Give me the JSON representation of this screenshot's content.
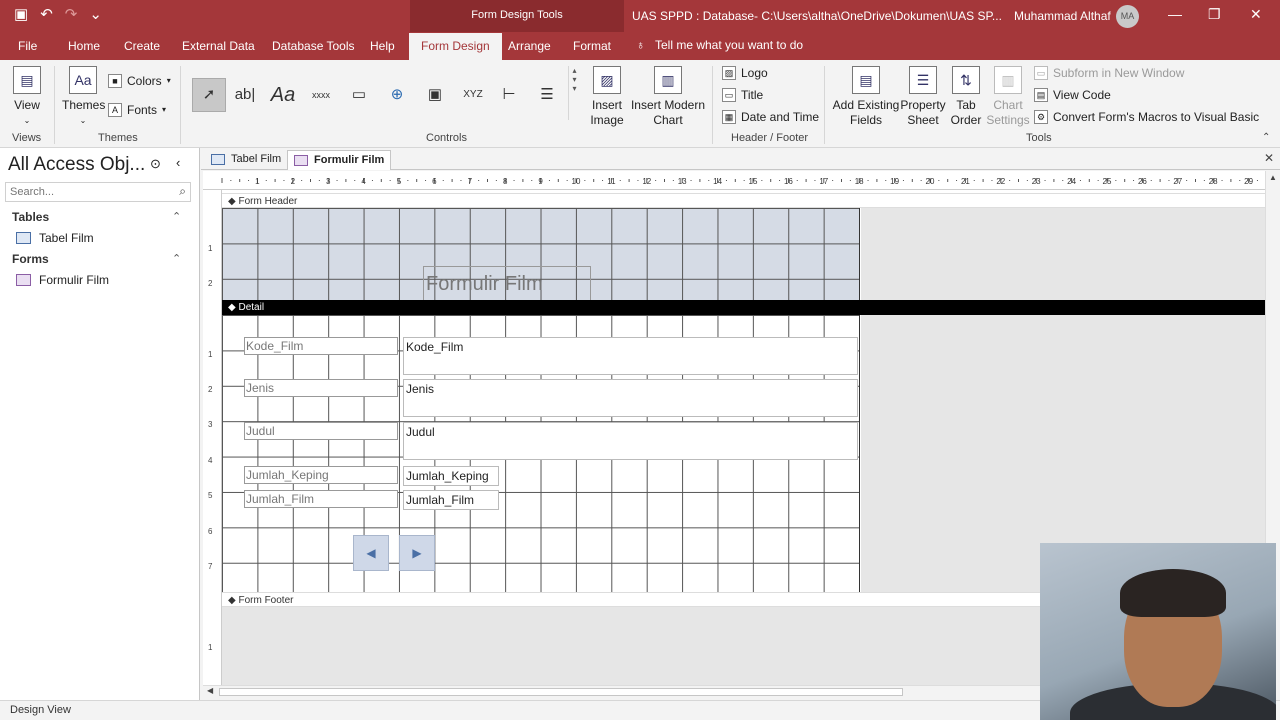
{
  "titlebar": {
    "contextual_tab": "Form Design Tools",
    "doc_title": "UAS SPPD : Database- C:\\Users\\altha\\OneDrive\\Dokumen\\UAS SP...",
    "user_name": "Muhammad Althaf",
    "user_initials": "MA"
  },
  "tabs": {
    "file": "File",
    "home": "Home",
    "create": "Create",
    "external_data": "External Data",
    "database_tools": "Database Tools",
    "help": "Help",
    "form_design": "Form Design",
    "arrange": "Arrange",
    "format": "Format",
    "tell_me": "Tell me what you want to do"
  },
  "ribbon": {
    "views": {
      "view_label": "View",
      "group_label": "Views"
    },
    "themes": {
      "themes_label": "Themes",
      "colors_label": "Colors",
      "fonts_label": "Fonts",
      "group_label": "Themes"
    },
    "controls": {
      "group_label": "Controls",
      "textbox_glyph": "ab|",
      "label_glyph": "Aa",
      "button_glyph": "xxxx",
      "chart_glyph": "XYZ"
    },
    "insert": {
      "image_line1": "Insert",
      "image_line2": "Image",
      "chart_line1": "Insert Modern",
      "chart_line2": "Chart"
    },
    "header_footer": {
      "logo": "Logo",
      "title": "Title",
      "date_time": "Date and Time",
      "group_label": "Header / Footer"
    },
    "tools": {
      "add_existing_line1": "Add Existing",
      "add_existing_line2": "Fields",
      "property_line1": "Property",
      "property_line2": "Sheet",
      "tab_order_line1": "Tab",
      "tab_order_line2": "Order",
      "chart_settings_line1": "Chart",
      "chart_settings_line2": "Settings",
      "subform": "Subform in New Window",
      "view_code": "View Code",
      "convert_macros": "Convert Form's Macros to Visual Basic",
      "group_label": "Tools"
    }
  },
  "navpane": {
    "title": "All Access Obj...",
    "search_placeholder": "Search...",
    "sections": [
      {
        "label": "Tables",
        "items": [
          "Tabel Film"
        ]
      },
      {
        "label": "Forms",
        "items": [
          "Formulir Film"
        ]
      }
    ]
  },
  "doc_tabs": [
    "Tabel Film",
    "Formulir Film"
  ],
  "ruler": {
    "numbers": [
      "1",
      "2",
      "3",
      "4",
      "5",
      "6",
      "7",
      "8",
      "9",
      "10",
      "11",
      "12",
      "13",
      "14",
      "15",
      "16",
      "17",
      "18",
      "19",
      "20",
      "21",
      "22",
      "23",
      "24",
      "25",
      "26",
      "27",
      "28",
      "29"
    ],
    "vertical_header": [
      "1",
      "2"
    ],
    "vertical_detail": [
      "1",
      "2",
      "3",
      "4",
      "5",
      "6",
      "7"
    ],
    "vertical_footer": [
      "1"
    ]
  },
  "form": {
    "header_section": "Form Header",
    "detail_section": "Detail",
    "footer_section": "Form Footer",
    "title_label": "Formulir Film",
    "fields": [
      {
        "label": "Kode_Film",
        "textbox": "Kode_Film"
      },
      {
        "label": "Jenis",
        "textbox": "Jenis"
      },
      {
        "label": "Judul",
        "textbox": "Judul"
      },
      {
        "label": "Jumlah_Keping",
        "textbox": "Jumlah_Keping"
      },
      {
        "label": "Jumlah_Film",
        "textbox": "Jumlah_Film"
      }
    ],
    "nav_prev_glyph": "◀",
    "nav_next_glyph": "▶"
  },
  "statusbar": {
    "text": "Design View"
  },
  "colors": {
    "accent": "#a4373a",
    "header_grid": "#d5dbe5",
    "nav_button": "#cfd8e8"
  }
}
